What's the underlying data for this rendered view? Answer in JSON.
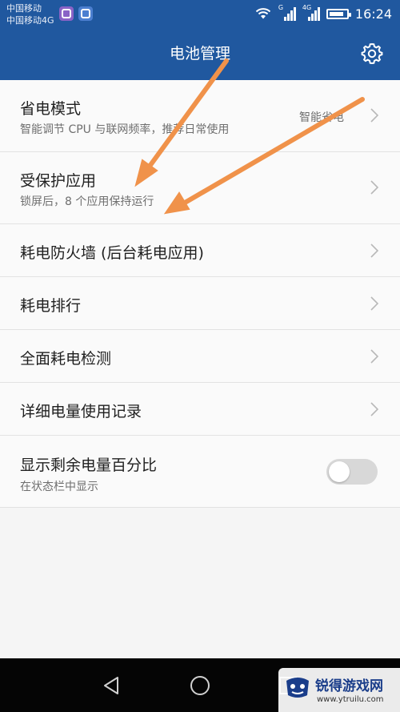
{
  "status_bar": {
    "carrier_1": "中国移动",
    "carrier_2": "中国移动4G",
    "signal_1_label": "G",
    "signal_2_label": "4G",
    "time": "16:24",
    "icons": [
      "notification-app-icon",
      "notification-baidu-icon",
      "wifi-icon",
      "signal-icon",
      "battery-icon"
    ]
  },
  "header": {
    "title": "电池管理",
    "settings_icon": "gear-icon",
    "background_color": "#20589f"
  },
  "settings": [
    {
      "title": "省电模式",
      "subtitle": "智能调节 CPU 与联网频率，推荐日常使用",
      "value": "智能省电",
      "control": "chevron"
    },
    {
      "title": "受保护应用",
      "subtitle": "锁屏后，8 个应用保持运行",
      "control": "chevron"
    },
    {
      "title": "耗电防火墙 (后台耗电应用)",
      "control": "chevron"
    },
    {
      "title": "耗电排行",
      "control": "chevron"
    },
    {
      "title": "全面耗电检测",
      "control": "chevron"
    },
    {
      "title": "详细电量使用记录",
      "control": "chevron"
    },
    {
      "title": "显示剩余电量百分比",
      "subtitle": "在状态栏中显示",
      "control": "toggle",
      "toggle_on": false
    }
  ],
  "annotation": {
    "arrow_color": "#f0924a"
  },
  "navbar": {
    "icons": [
      "back-icon",
      "home-icon",
      "recents-icon"
    ]
  },
  "watermark": {
    "name": "锐得游戏网",
    "url": "www.ytruilu.com"
  }
}
